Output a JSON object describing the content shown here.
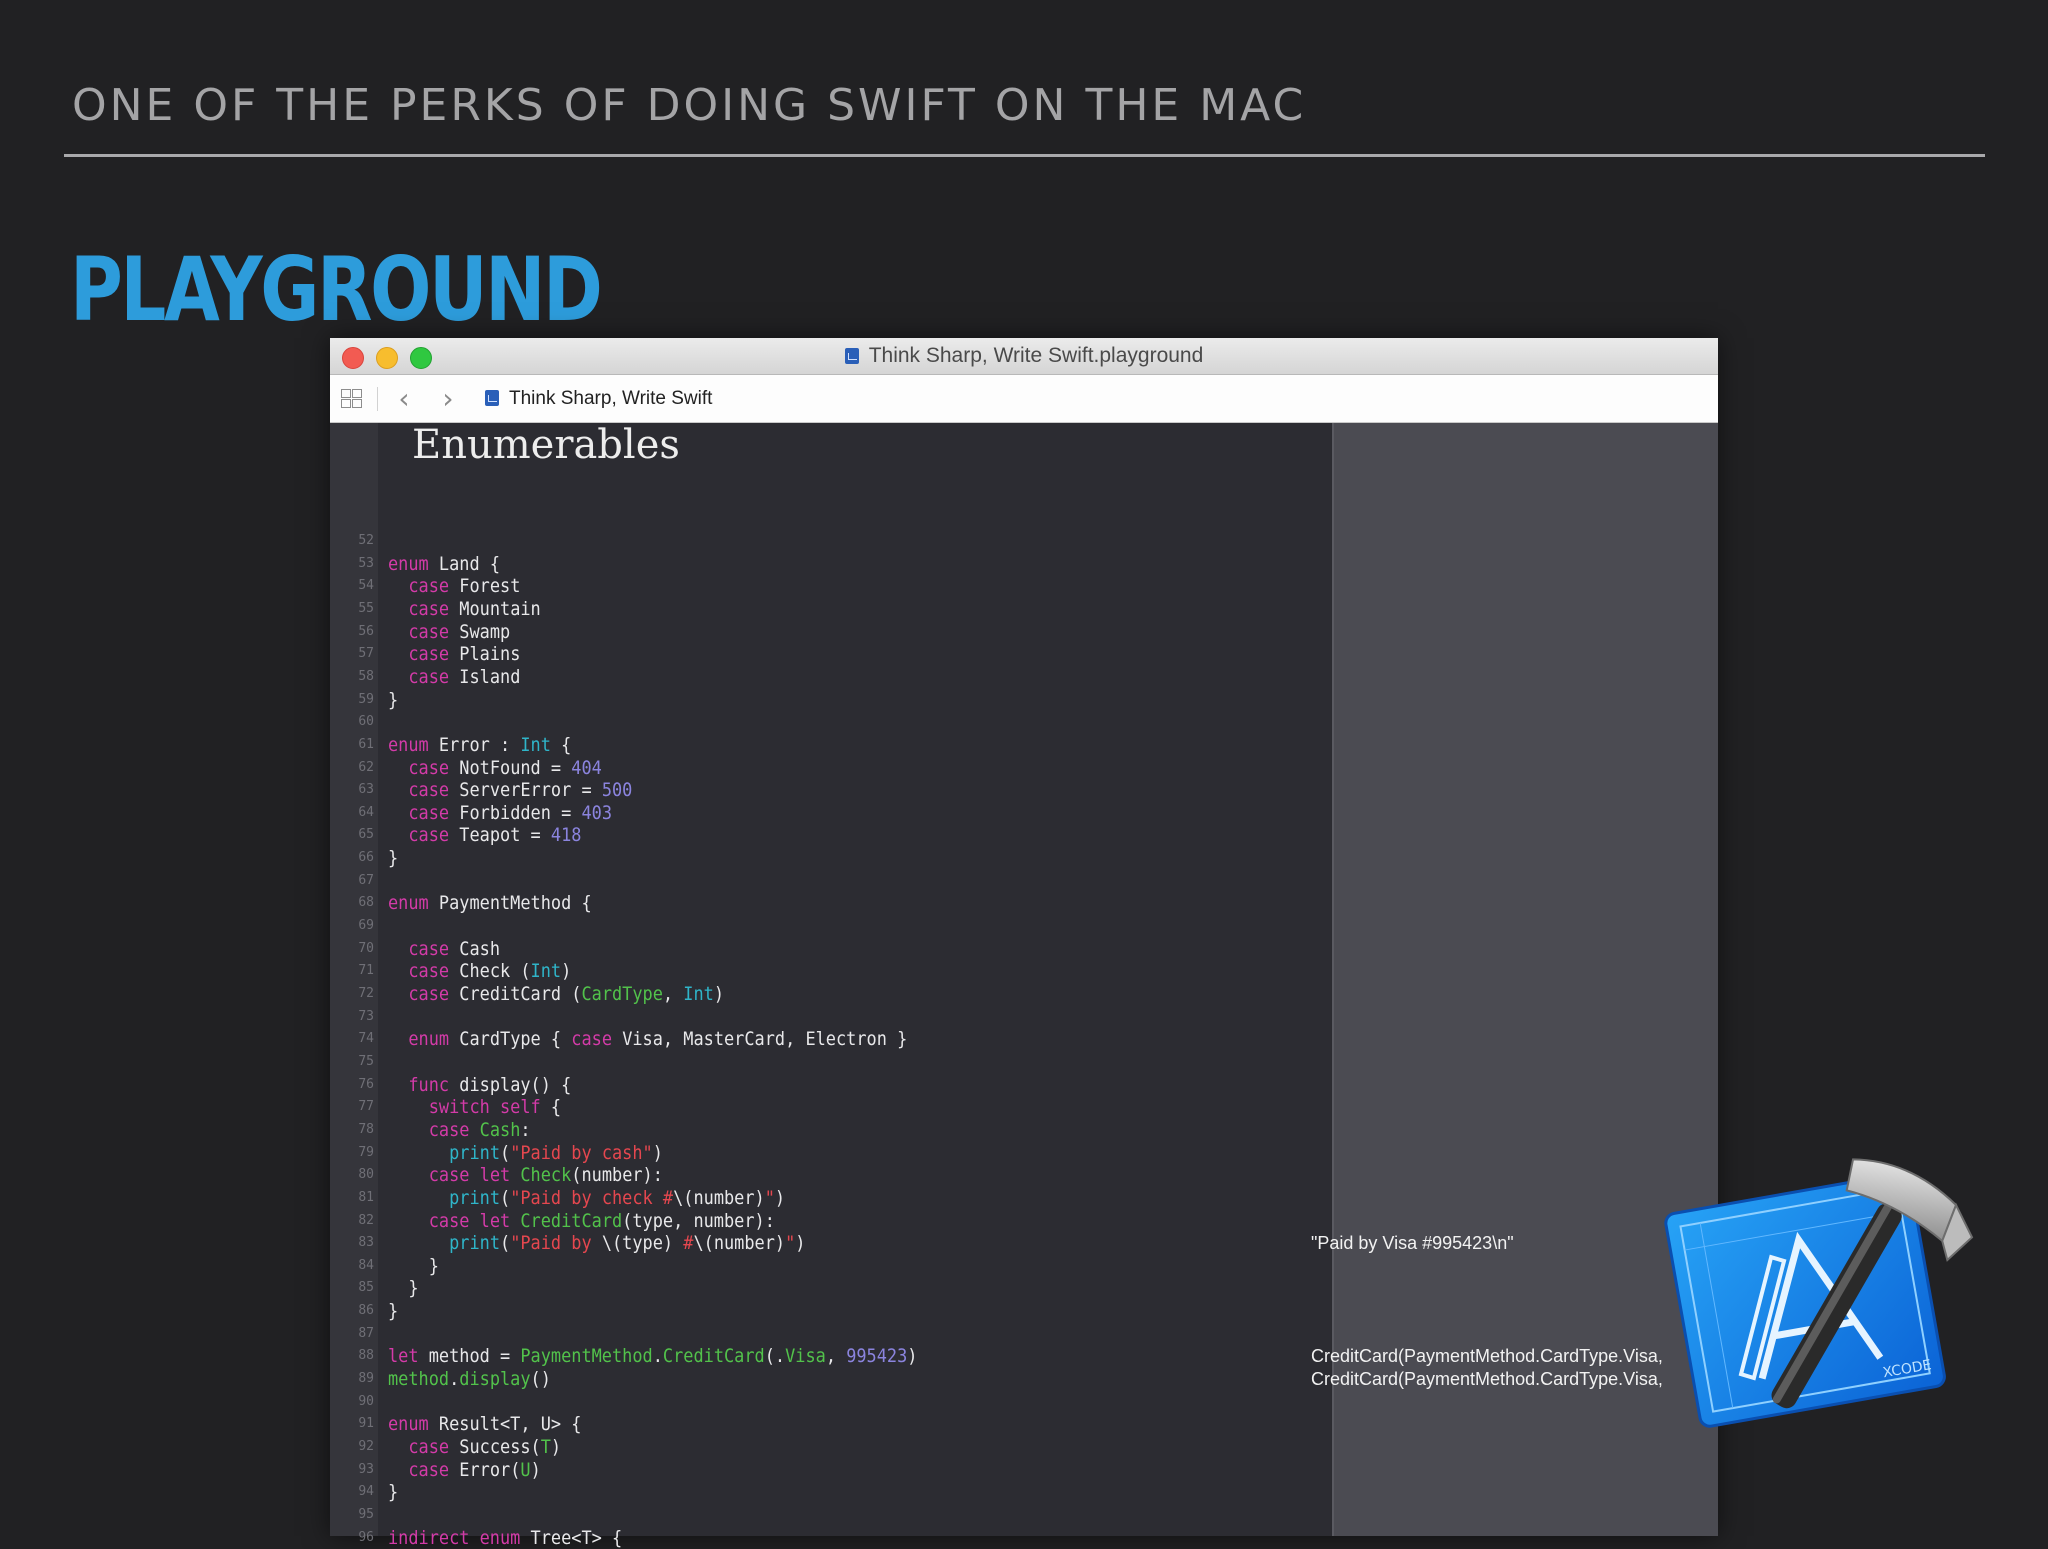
{
  "slide": {
    "heading": "ONE OF THE PERKS OF DOING SWIFT ON THE MAC",
    "title": "PLAYGROUND"
  },
  "window": {
    "title": "Think Sharp, Write Swift.playground",
    "toolbar": {
      "back_glyph": "‹",
      "forward_glyph": "›",
      "breadcrumb": "Think Sharp, Write Swift"
    }
  },
  "editor": {
    "doc_heading": "Enumerables",
    "lines": [
      {
        "number": "52",
        "parts": []
      },
      {
        "number": "53",
        "parts": [
          {
            "t": "enum",
            "k": "keyword"
          },
          {
            "t": " Land {",
            "k": "plain"
          }
        ]
      },
      {
        "number": "54",
        "parts": [
          {
            "t": "  ",
            "k": "plain"
          },
          {
            "t": "case",
            "k": "keyword"
          },
          {
            "t": " Forest",
            "k": "plain"
          }
        ]
      },
      {
        "number": "55",
        "parts": [
          {
            "t": "  ",
            "k": "plain"
          },
          {
            "t": "case",
            "k": "keyword"
          },
          {
            "t": " Mountain",
            "k": "plain"
          }
        ]
      },
      {
        "number": "56",
        "parts": [
          {
            "t": "  ",
            "k": "plain"
          },
          {
            "t": "case",
            "k": "keyword"
          },
          {
            "t": " Swamp",
            "k": "plain"
          }
        ]
      },
      {
        "number": "57",
        "parts": [
          {
            "t": "  ",
            "k": "plain"
          },
          {
            "t": "case",
            "k": "keyword"
          },
          {
            "t": " Plains",
            "k": "plain"
          }
        ]
      },
      {
        "number": "58",
        "parts": [
          {
            "t": "  ",
            "k": "plain"
          },
          {
            "t": "case",
            "k": "keyword"
          },
          {
            "t": " Island",
            "k": "plain"
          }
        ]
      },
      {
        "number": "59",
        "parts": [
          {
            "t": "}",
            "k": "plain"
          }
        ]
      },
      {
        "number": "60",
        "parts": []
      },
      {
        "number": "61",
        "parts": [
          {
            "t": "enum",
            "k": "keyword"
          },
          {
            "t": " Error : ",
            "k": "plain"
          },
          {
            "t": "Int",
            "k": "type"
          },
          {
            "t": " {",
            "k": "plain"
          }
        ]
      },
      {
        "number": "62",
        "parts": [
          {
            "t": "  ",
            "k": "plain"
          },
          {
            "t": "case",
            "k": "keyword"
          },
          {
            "t": " NotFound = ",
            "k": "plain"
          },
          {
            "t": "404",
            "k": "number"
          }
        ]
      },
      {
        "number": "63",
        "parts": [
          {
            "t": "  ",
            "k": "plain"
          },
          {
            "t": "case",
            "k": "keyword"
          },
          {
            "t": " ServerError = ",
            "k": "plain"
          },
          {
            "t": "500",
            "k": "number"
          }
        ]
      },
      {
        "number": "64",
        "parts": [
          {
            "t": "  ",
            "k": "plain"
          },
          {
            "t": "case",
            "k": "keyword"
          },
          {
            "t": " Forbidden = ",
            "k": "plain"
          },
          {
            "t": "403",
            "k": "number"
          }
        ]
      },
      {
        "number": "65",
        "parts": [
          {
            "t": "  ",
            "k": "plain"
          },
          {
            "t": "case",
            "k": "keyword"
          },
          {
            "t": " Teapot = ",
            "k": "plain"
          },
          {
            "t": "418",
            "k": "number"
          }
        ]
      },
      {
        "number": "66",
        "parts": [
          {
            "t": "}",
            "k": "plain"
          }
        ]
      },
      {
        "number": "67",
        "parts": []
      },
      {
        "number": "68",
        "parts": [
          {
            "t": "enum",
            "k": "keyword"
          },
          {
            "t": " PaymentMethod {",
            "k": "plain"
          }
        ]
      },
      {
        "number": "69",
        "parts": []
      },
      {
        "number": "70",
        "parts": [
          {
            "t": "  ",
            "k": "plain"
          },
          {
            "t": "case",
            "k": "keyword"
          },
          {
            "t": " Cash",
            "k": "plain"
          }
        ]
      },
      {
        "number": "71",
        "parts": [
          {
            "t": "  ",
            "k": "plain"
          },
          {
            "t": "case",
            "k": "keyword"
          },
          {
            "t": " Check (",
            "k": "plain"
          },
          {
            "t": "Int",
            "k": "type"
          },
          {
            "t": ")",
            "k": "plain"
          }
        ]
      },
      {
        "number": "72",
        "parts": [
          {
            "t": "  ",
            "k": "plain"
          },
          {
            "t": "case",
            "k": "keyword"
          },
          {
            "t": " CreditCard (",
            "k": "plain"
          },
          {
            "t": "CardType",
            "k": "method"
          },
          {
            "t": ", ",
            "k": "plain"
          },
          {
            "t": "Int",
            "k": "type"
          },
          {
            "t": ")",
            "k": "plain"
          }
        ]
      },
      {
        "number": "73",
        "parts": []
      },
      {
        "number": "74",
        "parts": [
          {
            "t": "  ",
            "k": "plain"
          },
          {
            "t": "enum",
            "k": "keyword"
          },
          {
            "t": " CardType { ",
            "k": "plain"
          },
          {
            "t": "case",
            "k": "keyword"
          },
          {
            "t": " Visa, MasterCard, Electron }",
            "k": "plain"
          }
        ]
      },
      {
        "number": "75",
        "parts": []
      },
      {
        "number": "76",
        "parts": [
          {
            "t": "  ",
            "k": "plain"
          },
          {
            "t": "func",
            "k": "keyword"
          },
          {
            "t": " display() {",
            "k": "plain"
          }
        ]
      },
      {
        "number": "77",
        "parts": [
          {
            "t": "    ",
            "k": "plain"
          },
          {
            "t": "switch self",
            "k": "keyword"
          },
          {
            "t": " {",
            "k": "plain"
          }
        ]
      },
      {
        "number": "78",
        "parts": [
          {
            "t": "    ",
            "k": "plain"
          },
          {
            "t": "case",
            "k": "keyword"
          },
          {
            "t": " ",
            "k": "plain"
          },
          {
            "t": "Cash",
            "k": "method"
          },
          {
            "t": ":",
            "k": "plain"
          }
        ]
      },
      {
        "number": "79",
        "parts": [
          {
            "t": "      ",
            "k": "plain"
          },
          {
            "t": "print",
            "k": "type"
          },
          {
            "t": "(",
            "k": "plain"
          },
          {
            "t": "\"Paid by cash\"",
            "k": "string"
          },
          {
            "t": ")",
            "k": "plain"
          }
        ]
      },
      {
        "number": "80",
        "parts": [
          {
            "t": "    ",
            "k": "plain"
          },
          {
            "t": "case let",
            "k": "keyword"
          },
          {
            "t": " ",
            "k": "plain"
          },
          {
            "t": "Check",
            "k": "method"
          },
          {
            "t": "(number):",
            "k": "plain"
          }
        ]
      },
      {
        "number": "81",
        "parts": [
          {
            "t": "      ",
            "k": "plain"
          },
          {
            "t": "print",
            "k": "type"
          },
          {
            "t": "(",
            "k": "plain"
          },
          {
            "t": "\"Paid by check #",
            "k": "string"
          },
          {
            "t": "\\(number)",
            "k": "plain"
          },
          {
            "t": "\"",
            "k": "string"
          },
          {
            "t": ")",
            "k": "plain"
          }
        ]
      },
      {
        "number": "82",
        "parts": [
          {
            "t": "    ",
            "k": "plain"
          },
          {
            "t": "case let",
            "k": "keyword"
          },
          {
            "t": " ",
            "k": "plain"
          },
          {
            "t": "CreditCard",
            "k": "method"
          },
          {
            "t": "(type, number):",
            "k": "plain"
          }
        ]
      },
      {
        "number": "83",
        "parts": [
          {
            "t": "      ",
            "k": "plain"
          },
          {
            "t": "print",
            "k": "type"
          },
          {
            "t": "(",
            "k": "plain"
          },
          {
            "t": "\"Paid by ",
            "k": "string"
          },
          {
            "t": "\\(type)",
            "k": "plain"
          },
          {
            "t": " #",
            "k": "string"
          },
          {
            "t": "\\(number)",
            "k": "plain"
          },
          {
            "t": "\"",
            "k": "string"
          },
          {
            "t": ")",
            "k": "plain"
          }
        ]
      },
      {
        "number": "84",
        "parts": [
          {
            "t": "    }",
            "k": "plain"
          }
        ]
      },
      {
        "number": "85",
        "parts": [
          {
            "t": "  }",
            "k": "plain"
          }
        ]
      },
      {
        "number": "86",
        "parts": [
          {
            "t": "}",
            "k": "plain"
          }
        ]
      },
      {
        "number": "87",
        "parts": []
      },
      {
        "number": "88",
        "parts": [
          {
            "t": "let",
            "k": "keyword"
          },
          {
            "t": " method = ",
            "k": "plain"
          },
          {
            "t": "PaymentMethod",
            "k": "method"
          },
          {
            "t": ".",
            "k": "plain"
          },
          {
            "t": "CreditCard",
            "k": "method"
          },
          {
            "t": "(.",
            "k": "plain"
          },
          {
            "t": "Visa",
            "k": "method"
          },
          {
            "t": ", ",
            "k": "plain"
          },
          {
            "t": "995423",
            "k": "number"
          },
          {
            "t": ")",
            "k": "plain"
          }
        ]
      },
      {
        "number": "89",
        "parts": [
          {
            "t": "method",
            "k": "method"
          },
          {
            "t": ".",
            "k": "plain"
          },
          {
            "t": "display",
            "k": "method"
          },
          {
            "t": "()",
            "k": "plain"
          }
        ]
      },
      {
        "number": "90",
        "parts": []
      },
      {
        "number": "91",
        "parts": [
          {
            "t": "enum",
            "k": "keyword"
          },
          {
            "t": " Result<T, U> {",
            "k": "plain"
          }
        ]
      },
      {
        "number": "92",
        "parts": [
          {
            "t": "  ",
            "k": "plain"
          },
          {
            "t": "case",
            "k": "keyword"
          },
          {
            "t": " Success(",
            "k": "plain"
          },
          {
            "t": "T",
            "k": "method"
          },
          {
            "t": ")",
            "k": "plain"
          }
        ]
      },
      {
        "number": "93",
        "parts": [
          {
            "t": "  ",
            "k": "plain"
          },
          {
            "t": "case",
            "k": "keyword"
          },
          {
            "t": " Error(",
            "k": "plain"
          },
          {
            "t": "U",
            "k": "method"
          },
          {
            "t": ")",
            "k": "plain"
          }
        ]
      },
      {
        "number": "94",
        "parts": [
          {
            "t": "}",
            "k": "plain"
          }
        ]
      },
      {
        "number": "95",
        "parts": []
      },
      {
        "number": "96",
        "parts": [
          {
            "t": "indirect enum",
            "k": "keyword"
          },
          {
            "t": " Tree<T> {",
            "k": "plain"
          }
        ]
      }
    ]
  },
  "results": [
    {
      "line": "83",
      "text": "\"Paid by Visa #995423\\n\""
    },
    {
      "line": "88",
      "text": "CreditCard(PaymentMethod.CardType.Visa,"
    },
    {
      "line": "89",
      "text": "CreditCard(PaymentMethod.CardType.Visa,"
    }
  ],
  "xcode_icon": {
    "label": "XCODE",
    "name": "xcode-app-icon"
  },
  "colors": {
    "accent": "#2d9cdb",
    "keyword": "#d33ba8",
    "type": "#2fb5c9",
    "number": "#8b84de",
    "string": "#e5474f",
    "method": "#52c24b"
  }
}
